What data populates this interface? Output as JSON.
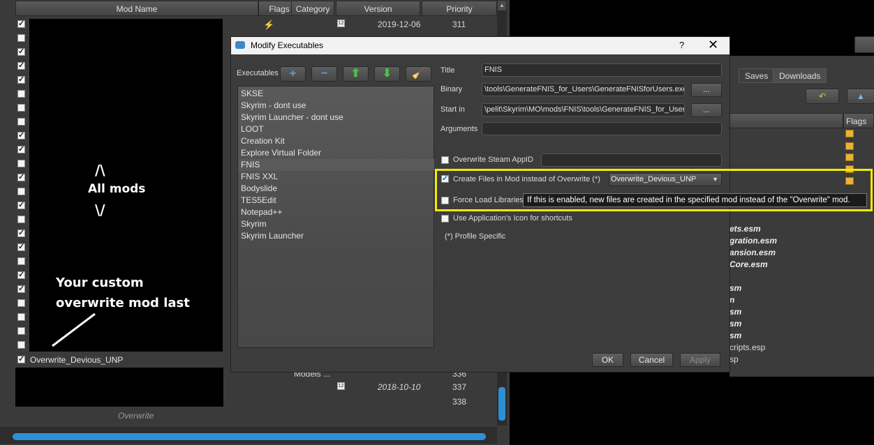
{
  "modlist": {
    "headers": {
      "name": "Mod Name",
      "flags": "Flags",
      "category": "Category",
      "version": "Version",
      "priority": "Priority"
    },
    "top_row": {
      "version": "2019-12-06",
      "priority": "311"
    },
    "annotation_all_mods": {
      "up": "/\\",
      "label": "All mods",
      "down": "\\/"
    },
    "annotation_custom": {
      "line1": "Your custom",
      "line2": "overwrite mod last"
    },
    "custom_row_name": "Overwrite_Devious_UNP",
    "rows_below": [
      {
        "text": "Models ...",
        "priority": "336"
      },
      {
        "version": "2018-10-10",
        "priority": "337"
      },
      {
        "priority": "338"
      }
    ],
    "overwrite_row": "Overwrite"
  },
  "background_window": {
    "tabs": [
      "Saves",
      "Downloads"
    ],
    "flags_header": "Flags",
    "plugins": [
      "ets.esm",
      "gration.esm",
      "ansion.esm",
      "Core.esm",
      "sm",
      "n",
      "sm",
      "sm",
      "sm"
    ],
    "plain_plugins": [
      "cripts.esp",
      "sp"
    ]
  },
  "dialog": {
    "title": "Modify Executables",
    "help": "?",
    "close": "✕",
    "executables_label": "Executables",
    "executables": [
      "SKSE",
      "Skyrim - dont use",
      "Skyrim Launcher - dont use",
      "LOOT",
      "Creation Kit",
      "Explore Virtual Folder",
      "FNIS",
      "FNIS XXL",
      "Bodyslide",
      "TES5Edit",
      "Notepad++",
      "Skyrim",
      "Skyrim Launcher"
    ],
    "selected_index": 6,
    "title_label": "Title",
    "title_value": "FNIS",
    "binary_label": "Binary",
    "binary_value": "\\tools\\GenerateFNIS_for_Users\\GenerateFNISforUsers.exe",
    "start_label": "Start in",
    "start_value": "\\pelit\\Skyrim\\MO\\mods\\FNIS\\tools\\GenerateFNIS_for_Users",
    "browse": "...",
    "arguments_label": "Arguments",
    "arguments_value": "",
    "overwrite_appid": "Overwrite Steam AppID",
    "create_files": "Create Files in Mod instead of Overwrite (*)",
    "create_files_target": "Overwrite_Devious_UNP",
    "force_load": "Force Load Libraries",
    "app_icon": "Use Application's Icon for shortcuts",
    "profile_specific": "(*) Profile Specific",
    "tooltip": "If this is enabled, new files are created in the specified mod instead of the \"Overwrite\" mod.",
    "ok": "OK",
    "cancel": "Cancel",
    "apply": "Apply"
  },
  "colors": {
    "highlight": "#f3ea00",
    "accent": "#2f8fd6"
  }
}
